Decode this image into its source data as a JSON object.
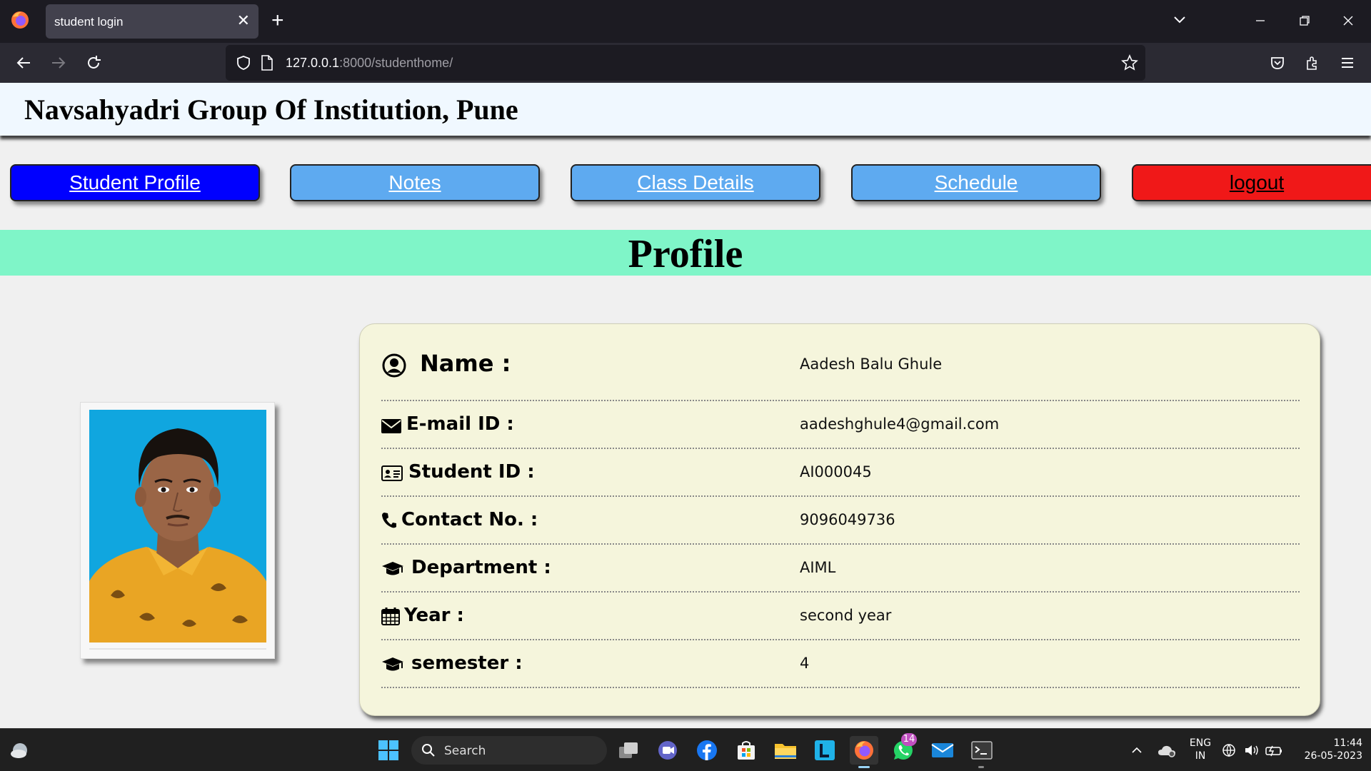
{
  "browser": {
    "tab_title": "student login",
    "url_host": "127.0.0.1",
    "url_rest": ":8000/studenthome/"
  },
  "site": {
    "title": "Navsahyadri Group Of Institution, Pune"
  },
  "nav": {
    "student_profile": "Student Profile",
    "notes": "Notes",
    "class_details": "Class Details",
    "schedule": "Schedule",
    "logout": "logout"
  },
  "section": {
    "title": "Profile"
  },
  "profile": {
    "fields": [
      {
        "label": "Name :",
        "value": "Aadesh Balu Ghule",
        "icon": "user-circle-icon"
      },
      {
        "label": "E-mail ID :",
        "value": "aadeshghule4@gmail.com",
        "icon": "envelope-icon"
      },
      {
        "label": "Student ID :",
        "value": "AI000045",
        "icon": "id-card-icon"
      },
      {
        "label": "Contact No. :",
        "value": "9096049736",
        "icon": "phone-icon"
      },
      {
        "label": "Department :",
        "value": "AIML",
        "icon": "graduation-cap-icon"
      },
      {
        "label": "Year :",
        "value": "second year",
        "icon": "calendar-icon"
      },
      {
        "label": "semester :",
        "value": "4",
        "icon": "graduation-cap-icon"
      }
    ]
  },
  "taskbar": {
    "search": "Search",
    "whatsapp_badge": "14",
    "lang_line1": "ENG",
    "lang_line2": "IN",
    "time": "11:44",
    "date": "26-05-2023"
  },
  "colors": {
    "active_button": "#0000ff",
    "nav_button": "#5eaaf0",
    "logout_button": "#f01818",
    "section_bar": "#7ff5c8",
    "card_bg": "#f5f5dc"
  }
}
